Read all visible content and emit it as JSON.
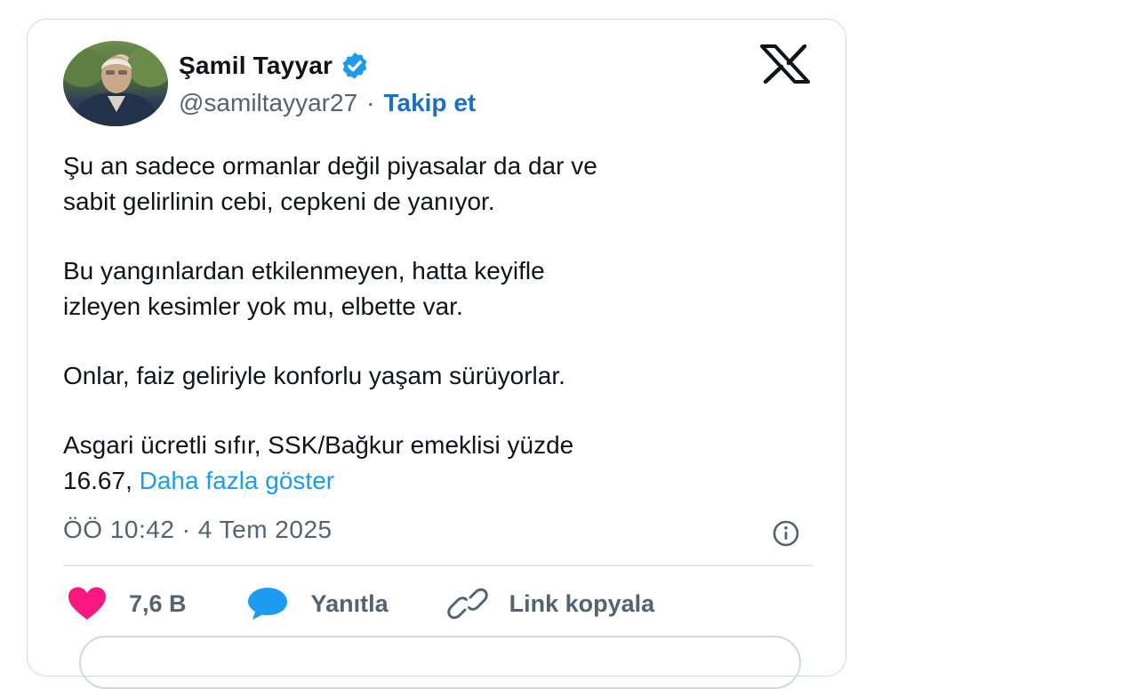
{
  "tweet": {
    "author_name": "Şamil Tayyar",
    "handle": "@samiltayyar27",
    "separator": "·",
    "follow_label": "Takip et",
    "paragraphs": [
      "Şu an sadece ormanlar değil piyasalar da dar ve\nsabit gelirlinin cebi, cepkeni de yanıyor.",
      "Bu yangınlardan etkilenmeyen, hatta keyifle\nizleyen kesimler yok mu, elbette var.",
      "Onlar, faiz geliriyle konforlu yaşam sürüyorlar.",
      "Asgari ücretli sıfır, SSK/Bağkur emeklisi yüzde\n16.67, "
    ],
    "show_more_label": "Daha fazla göster",
    "timestamp": "ÖÖ 10:42 · 4 Tem 2025"
  },
  "actions": {
    "like_count": "7,6 B",
    "reply_label": "Yanıtla",
    "copy_link_label": "Link kopyala"
  },
  "icons": {
    "verified": "verified-badge-icon",
    "logo": "x-logo-icon",
    "info": "info-icon",
    "like": "heart-icon",
    "reply": "speech-bubble-icon",
    "link": "link-icon"
  },
  "colors": {
    "verified_blue": "#1d9bf0",
    "follow_blue": "#1d6fc2",
    "like_pink": "#f91880",
    "secondary_text": "#536471",
    "border": "#cfd9de"
  }
}
